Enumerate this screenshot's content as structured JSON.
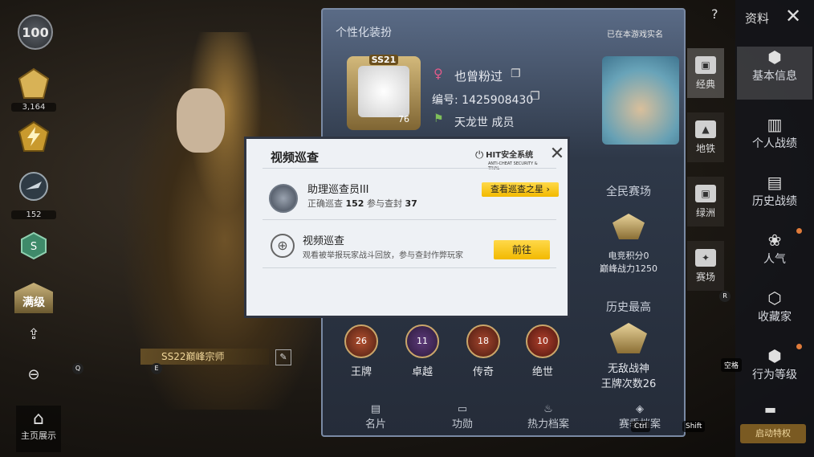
{
  "left_column": {
    "level": "100",
    "rank_badges": [
      {
        "icon": "rank-emblem-icon",
        "value": "3,164"
      },
      {
        "icon": "lightning-emblem-icon",
        "value": ""
      },
      {
        "icon": "plane-emblem-icon",
        "value": "152"
      }
    ],
    "max_level_label": "满级",
    "home_button_label": "主页展示",
    "name_banner": "SS22巅峰宗师",
    "key_hints": {
      "q": "Q",
      "e": "E"
    }
  },
  "profile": {
    "panel_title": "个性化装扮",
    "verified_note": "已在本游戏实名",
    "frame_badge": "SS21",
    "frame_level": "76",
    "nickname": "也曾粉过",
    "uid_label": "编号: 1425908430",
    "clan": "天龙世 成员",
    "mode_title": "全民赛场",
    "score_line": "电竞积分0",
    "power_line": "巅峰战力1250",
    "history_title": "历史最高",
    "history_rank": "无敌战神",
    "history_count": "王牌次数26",
    "tiers": [
      {
        "label": "王牌",
        "count": "26"
      },
      {
        "label": "卓越",
        "count": "11"
      },
      {
        "label": "传奇",
        "count": "18"
      },
      {
        "label": "绝世",
        "count": "10"
      }
    ],
    "bottom_tabs": [
      "名片",
      "功勋",
      "热力档案",
      "赛季档案"
    ]
  },
  "mid_tabs": [
    "经典",
    "地铁",
    "绿洲",
    "赛场"
  ],
  "right_tabs": [
    "基本信息",
    "个人战绩",
    "历史战绩",
    "人气",
    "收藏家",
    "行为等级"
  ],
  "top_bar": {
    "title": "资料",
    "help": "?",
    "close": "✕"
  },
  "promo_label": "启动特权",
  "key_tags": {
    "r": "R",
    "space": "空格",
    "ctrl": "Ctrl",
    "shift": "Shift"
  },
  "modal": {
    "title": "视频巡查",
    "brand": "HIT安全系统",
    "brand_sub": "ANTI-CHEAT SECURITY & TRIAL",
    "row1_title": "助理巡查员III",
    "row1_prefix": "正确巡查",
    "row1_correct": "152",
    "row1_mid": "参与查封",
    "row1_ban": "37",
    "row1_button": "查看巡查之星 ›",
    "row2_title": "视频巡查",
    "row2_desc": "观看被举报玩家战斗回放，参与查封作弊玩家",
    "row2_button": "前往"
  }
}
